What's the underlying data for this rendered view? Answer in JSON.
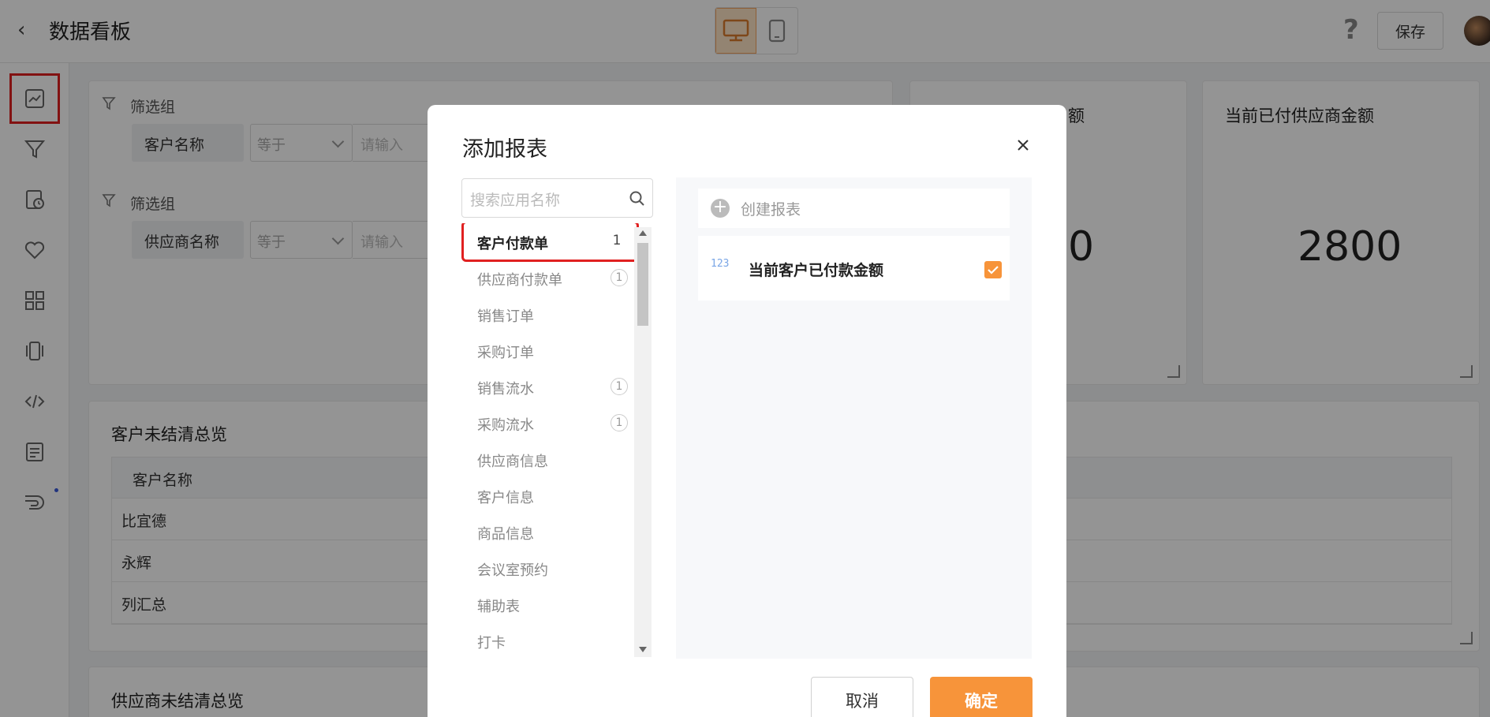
{
  "header": {
    "title": "数据看板",
    "save_label": "保存",
    "help_label": "?"
  },
  "filters": [
    {
      "group_label": "筛选组",
      "field": "客户名称",
      "operator": "等于",
      "placeholder": "请输入"
    },
    {
      "group_label": "筛选组",
      "field": "供应商名称",
      "operator": "等于",
      "placeholder": "请输入"
    }
  ],
  "kpis": [
    {
      "title_partial": "额",
      "value_partial": "0"
    },
    {
      "title": "当前已付供应商金额",
      "value": "2800"
    }
  ],
  "customer_table": {
    "title": "客户未结清总览",
    "header": "客户名称",
    "rows": [
      "比宜德",
      "永辉",
      "列汇总"
    ]
  },
  "supplier_section_title": "供应商未结清总览",
  "modal": {
    "title": "添加报表",
    "search_placeholder": "搜索应用名称",
    "apps": [
      {
        "label": "客户付款单",
        "count": "1"
      },
      {
        "label": "供应商付款单",
        "count": "1"
      },
      {
        "label": "销售订单",
        "count": ""
      },
      {
        "label": "采购订单",
        "count": ""
      },
      {
        "label": "销售流水",
        "count": "1"
      },
      {
        "label": "采购流水",
        "count": "1"
      },
      {
        "label": "供应商信息",
        "count": ""
      },
      {
        "label": "客户信息",
        "count": ""
      },
      {
        "label": "商品信息",
        "count": ""
      },
      {
        "label": "会议室预约",
        "count": ""
      },
      {
        "label": "辅助表",
        "count": ""
      },
      {
        "label": "打卡",
        "count": ""
      }
    ],
    "create_label": "创建报表",
    "report": {
      "icon_text": "123",
      "name": "当前客户已付款金额",
      "checked": true
    },
    "cancel_label": "取消",
    "ok_label": "确定"
  },
  "colors": {
    "accent": "#f7943a",
    "highlight": "#e02020"
  }
}
